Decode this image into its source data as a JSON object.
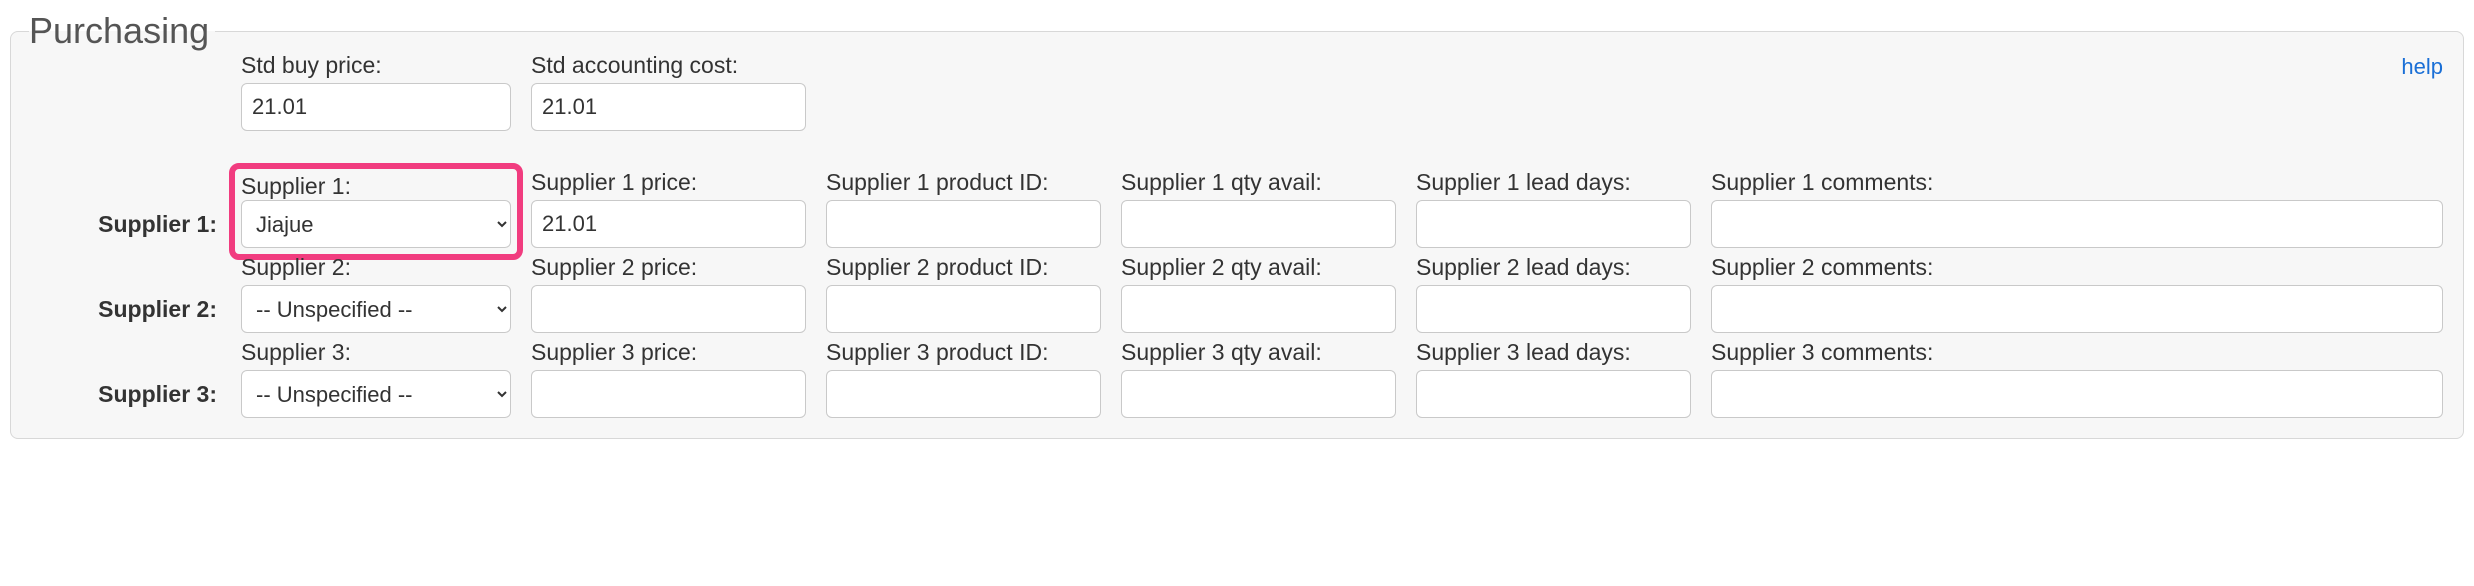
{
  "section": {
    "title": "Purchasing",
    "help_label": "help"
  },
  "top": {
    "std_buy_price_label": "Std buy price:",
    "std_buy_price_value": "21.01",
    "std_accounting_cost_label": "Std accounting cost:",
    "std_accounting_cost_value": "21.01"
  },
  "supplier_rows": [
    {
      "row_label": "Supplier 1:",
      "supplier_label": "Supplier 1:",
      "supplier_value": "Jiajue",
      "price_label": "Supplier 1 price:",
      "price_value": "21.01",
      "product_id_label": "Supplier 1 product ID:",
      "product_id_value": "",
      "qty_avail_label": "Supplier 1 qty avail:",
      "qty_avail_value": "",
      "lead_days_label": "Supplier 1 lead days:",
      "lead_days_value": "",
      "comments_label": "Supplier 1 comments:",
      "comments_value": ""
    },
    {
      "row_label": "Supplier 2:",
      "supplier_label": "Supplier 2:",
      "supplier_value": "-- Unspecified --",
      "price_label": "Supplier 2 price:",
      "price_value": "",
      "product_id_label": "Supplier 2 product ID:",
      "product_id_value": "",
      "qty_avail_label": "Supplier 2 qty avail:",
      "qty_avail_value": "",
      "lead_days_label": "Supplier 2 lead days:",
      "lead_days_value": "",
      "comments_label": "Supplier 2 comments:",
      "comments_value": ""
    },
    {
      "row_label": "Supplier 3:",
      "supplier_label": "Supplier 3:",
      "supplier_value": "-- Unspecified --",
      "price_label": "Supplier 3 price:",
      "price_value": "",
      "product_id_label": "Supplier 3 product ID:",
      "product_id_value": "",
      "qty_avail_label": "Supplier 3 qty avail:",
      "qty_avail_value": "",
      "lead_days_label": "Supplier 3 lead days:",
      "lead_days_value": "",
      "comments_label": "Supplier 3 comments:",
      "comments_value": ""
    }
  ],
  "supplier_options": [
    "-- Unspecified --",
    "Jiajue"
  ]
}
